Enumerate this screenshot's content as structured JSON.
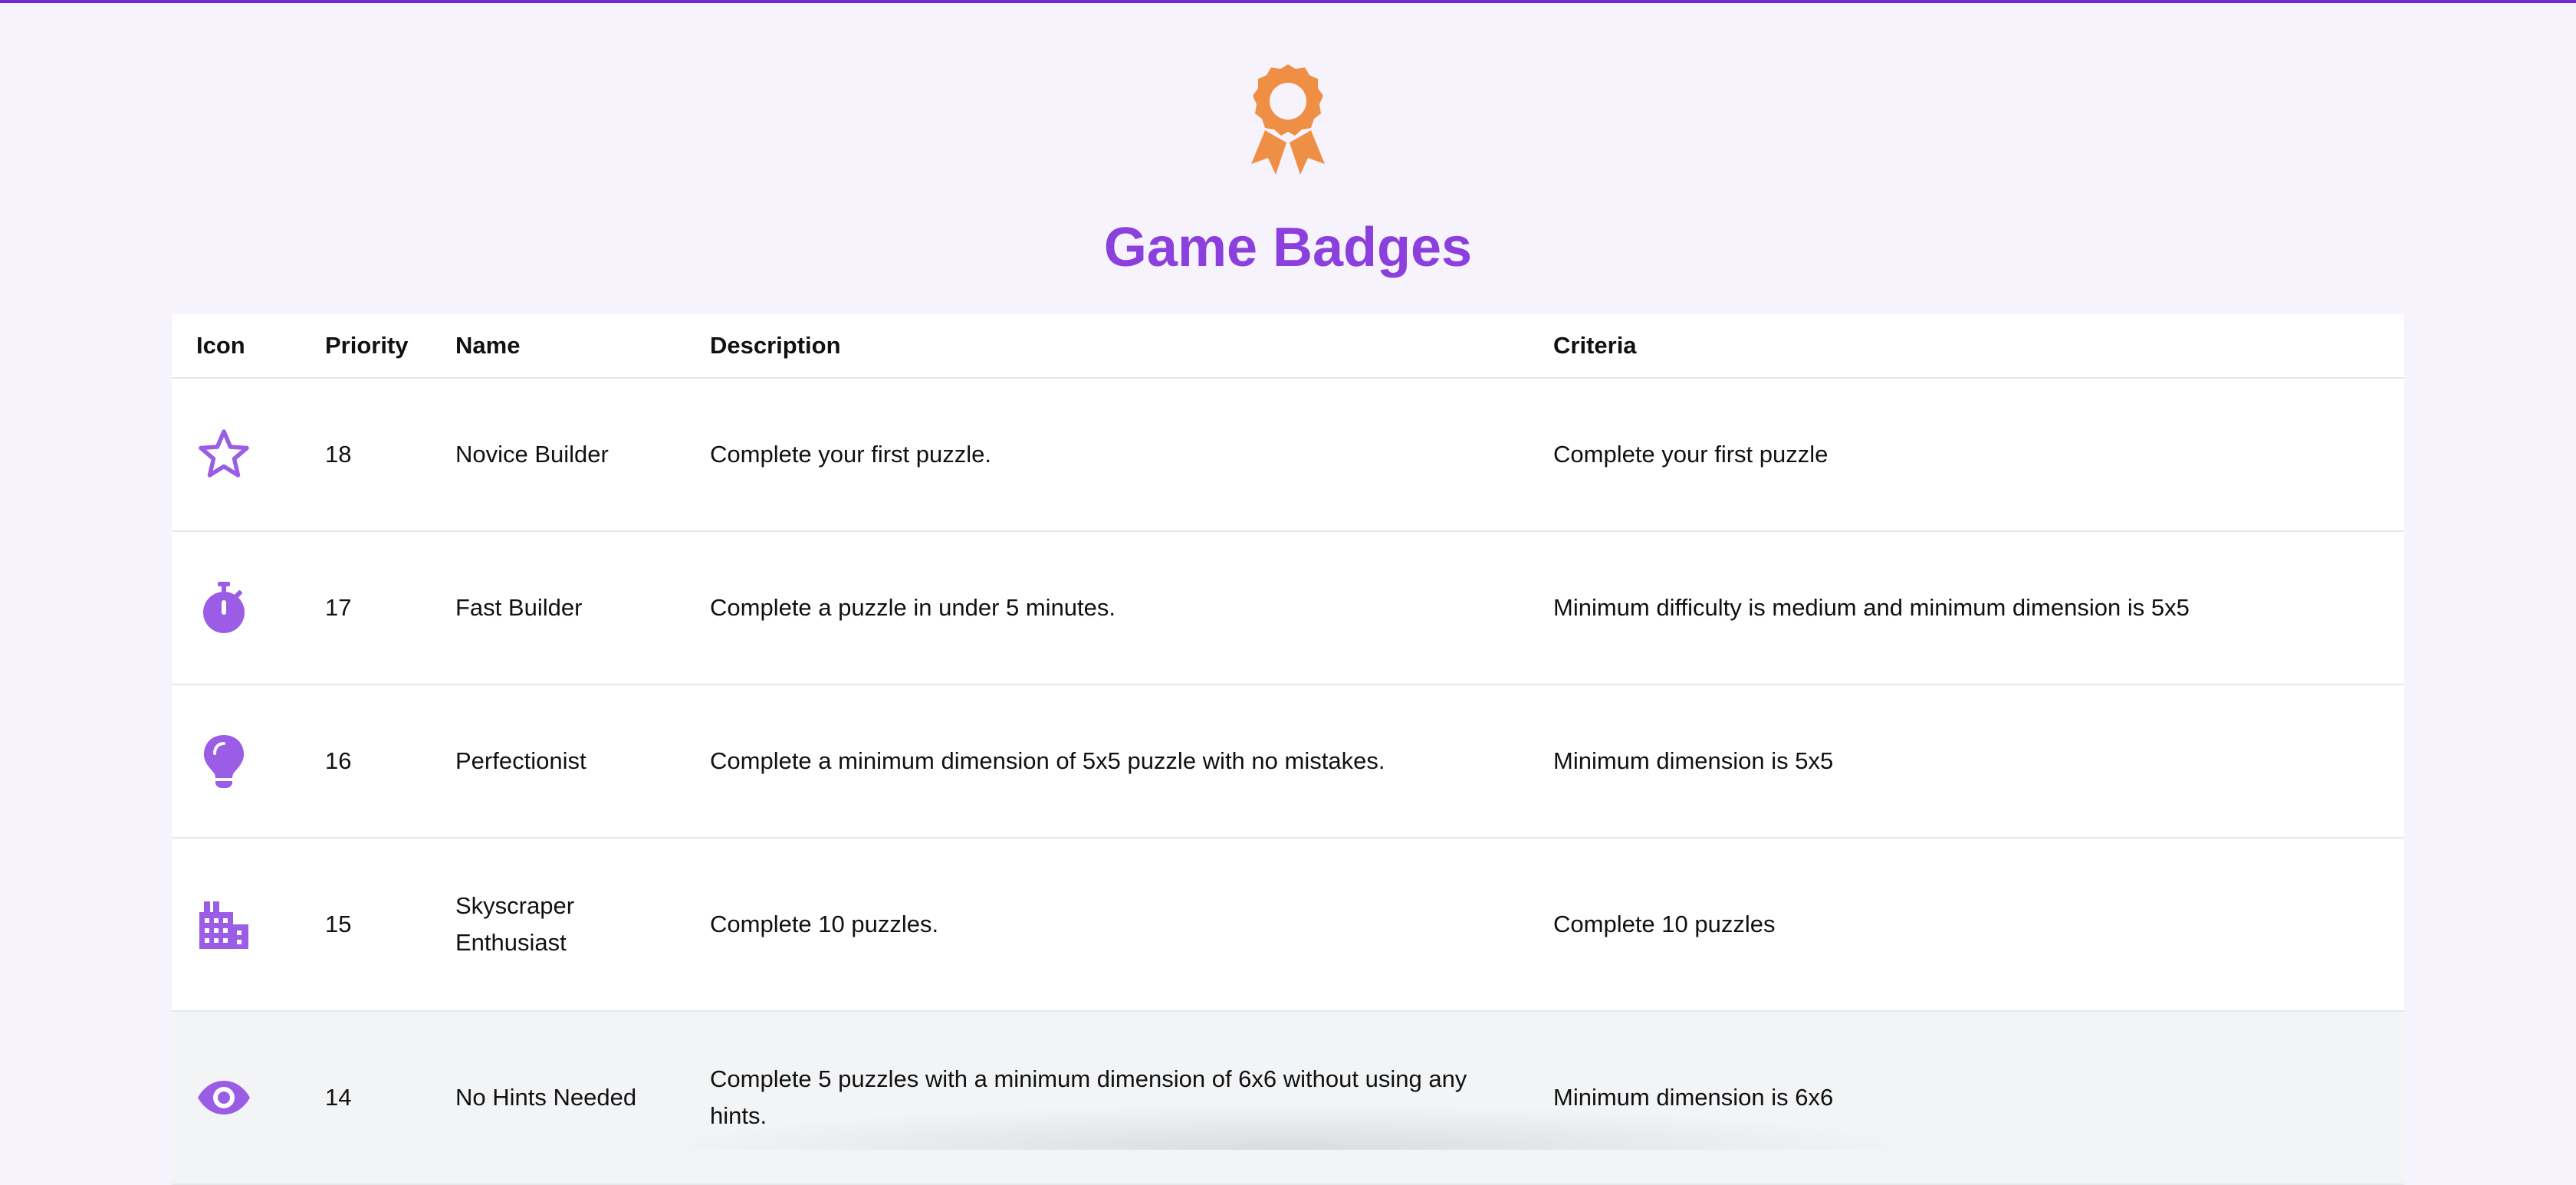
{
  "header": {
    "icon": "award-ribbon-icon",
    "title": "Game Badges",
    "accent_color": "#8b3fdc",
    "award_color": "#ef8f46"
  },
  "table": {
    "columns": [
      "Icon",
      "Priority",
      "Name",
      "Description",
      "Criteria"
    ],
    "rows": [
      {
        "icon": "star-outline-icon",
        "priority": "18",
        "name": "Novice Builder",
        "description": "Complete your first puzzle.",
        "criteria": "Complete your first puzzle"
      },
      {
        "icon": "stopwatch-icon",
        "priority": "17",
        "name": "Fast Builder",
        "description": "Complete a puzzle in under 5 minutes.",
        "criteria": "Minimum difficulty is medium and minimum dimension is 5x5"
      },
      {
        "icon": "lightbulb-icon",
        "priority": "16",
        "name": "Perfectionist",
        "description": "Complete a minimum dimension of 5x5 puzzle with no mistakes.",
        "criteria": "Minimum dimension is 5x5"
      },
      {
        "icon": "building-icon",
        "priority": "15",
        "name": "Skyscraper Enthusiast",
        "description": "Complete 10 puzzles.",
        "criteria": "Complete 10 puzzles"
      },
      {
        "icon": "eye-icon",
        "priority": "14",
        "name": "No Hints Needed",
        "description": "Complete 5 puzzles with a minimum dimension of 6x6 without using any hints.",
        "criteria": "Minimum dimension is 6x6"
      }
    ],
    "icon_color": "#9b5de5"
  }
}
